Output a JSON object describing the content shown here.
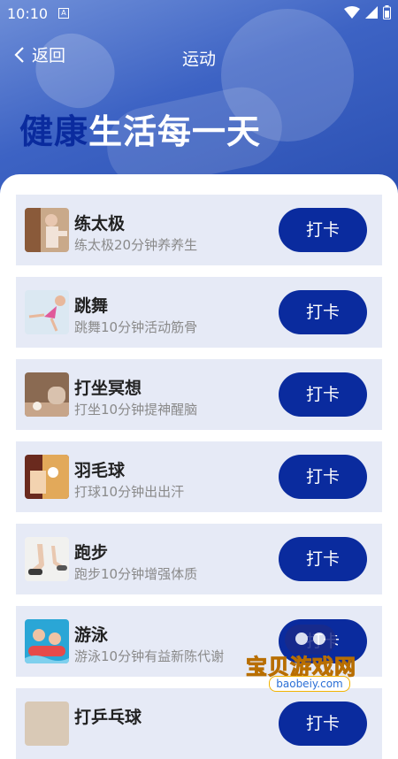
{
  "status_bar": {
    "time": "10:10",
    "notice_icon": "a-notification-icon",
    "wifi_icon": "wifi-icon",
    "battery_icon": "battery-icon"
  },
  "nav": {
    "back_label": "返回",
    "title": "运动"
  },
  "hero": {
    "slogan_part1": "健康",
    "slogan_part2": "生活每一天"
  },
  "colors": {
    "accent": "#0a2b9e",
    "card_bg": "#e6eaf6",
    "hero": "#3d63c4"
  },
  "activities": [
    {
      "title": "练太极",
      "desc": "练太极20分钟养养生",
      "button": "打卡"
    },
    {
      "title": "跳舞",
      "desc": "跳舞10分钟活动筋骨",
      "button": "打卡"
    },
    {
      "title": "打坐冥想",
      "desc": "打坐10分钟提神醒脑",
      "button": "打卡"
    },
    {
      "title": "羽毛球",
      "desc": "打球10分钟出出汗",
      "button": "打卡"
    },
    {
      "title": "跑步",
      "desc": "跑步10分钟增强体质",
      "button": "打卡"
    },
    {
      "title": "游泳",
      "desc": "游泳10分钟有益新陈代谢",
      "button": "打卡"
    },
    {
      "title": "打乒乓球",
      "desc": "",
      "button": "打卡"
    }
  ],
  "watermark": {
    "text": "宝贝游戏网",
    "url": "baobeiy.com"
  }
}
